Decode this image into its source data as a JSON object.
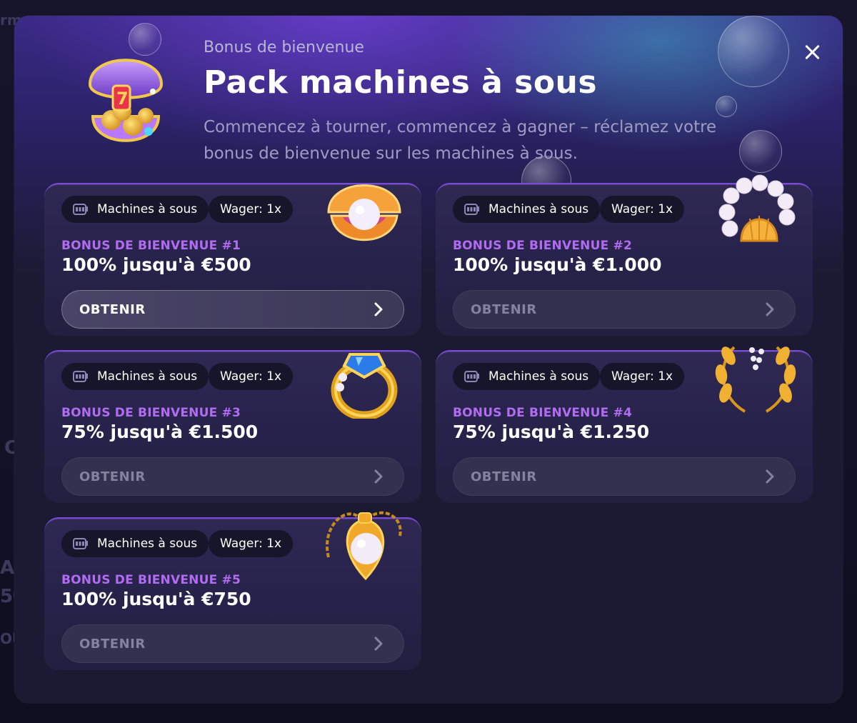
{
  "modal": {
    "eyebrow": "Bonus de bienvenue",
    "title": "Pack machines à sous",
    "subtitle": "Commencez à tourner, commencez à gagner – réclamez votre bonus de bienvenue sur les machines à sous.",
    "close_icon": "close-icon"
  },
  "cards": [
    {
      "category": "Machines à sous",
      "wager": "Wager: 1x",
      "label": "BONUS DE BIENVENUE #1",
      "amount": "100% jusqu'à €500",
      "cta": "OBTENIR",
      "art": "pearl-shell-icon"
    },
    {
      "category": "Machines à sous",
      "wager": "Wager: 1x",
      "label": "BONUS DE BIENVENUE #2",
      "amount": "100% jusqu'à €1.000",
      "cta": "OBTENIR",
      "art": "pearl-bracelet-icon"
    },
    {
      "category": "Machines à sous",
      "wager": "Wager: 1x",
      "label": "BONUS DE BIENVENUE #3",
      "amount": "75% jusqu'à €1.500",
      "cta": "OBTENIR",
      "art": "sapphire-ring-icon"
    },
    {
      "category": "Machines à sous",
      "wager": "Wager: 1x",
      "label": "BONUS DE BIENVENUE #4",
      "amount": "75% jusqu'à €1.250",
      "cta": "OBTENIR",
      "art": "laurel-wreath-icon"
    },
    {
      "category": "Machines à sous",
      "wager": "Wager: 1x",
      "label": "BONUS DE BIENVENUE #5",
      "amount": "100% jusqu'à €750",
      "cta": "OBTENIR",
      "art": "pearl-pendant-icon"
    }
  ],
  "colors": {
    "accent_purple": "#b26cf2",
    "card_border": "#7a4bd8",
    "chip_bg": "#16152a"
  }
}
